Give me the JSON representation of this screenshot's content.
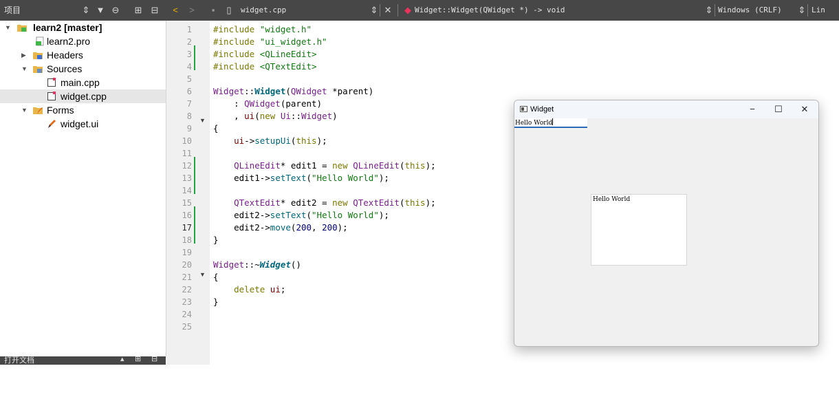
{
  "topbar": {
    "project_label": "项目",
    "file_name": "widget.cpp",
    "symbol": "Widget::Widget(QWidget *) -> void",
    "line_ending": "Windows (CRLF)",
    "line_label": "Lin"
  },
  "tree": {
    "project": "learn2 [master]",
    "pro_file": "learn2.pro",
    "headers": "Headers",
    "sources": "Sources",
    "main_cpp": "main.cpp",
    "widget_cpp": "widget.cpp",
    "forms": "Forms",
    "widget_ui": "widget.ui"
  },
  "open_docs_label": "打开文档",
  "line_numbers": [
    "1",
    "2",
    "3",
    "4",
    "5",
    "6",
    "7",
    "8",
    "9",
    "10",
    "11",
    "12",
    "13",
    "14",
    "15",
    "16",
    "17",
    "18",
    "19",
    "20",
    "21",
    "22",
    "23",
    "24",
    "25"
  ],
  "code": {
    "l1_kw": "#include",
    "l1_str": "\"widget.h\"",
    "l2_kw": "#include",
    "l2_str": "\"ui_widget.h\"",
    "l3_kw": "#include",
    "l3_str": "<QLineEdit>",
    "l4_kw": "#include",
    "l4_str": "<QTextEdit>",
    "l6_cls": "Widget",
    "l6_sep": "::",
    "l6_fn": "Widget",
    "l6_open": "(",
    "l6_type": "QWidget",
    "l6_rest": " *parent)",
    "l7_pre": "    : ",
    "l7_type": "QWidget",
    "l7_rest": "(parent)",
    "l8_pre": "    , ",
    "l8_mem": "ui",
    "l8_o": "(",
    "l8_kw": "new",
    "l8_sp": " ",
    "l8_ns": "Ui",
    "l8_sep": "::",
    "l8_cls": "Widget",
    "l8_c": ")",
    "l9": "{",
    "l10_pre": "    ",
    "l10_mem": "ui",
    "l10_arr": "->",
    "l10_fn": "setupUi",
    "l10_o": "(",
    "l10_kw": "this",
    "l10_c": ");",
    "l12_pre": "    ",
    "l12_type": "QLineEdit",
    "l12_mid": "* edit1 = ",
    "l12_kw": "new",
    "l12_sp": " ",
    "l12_type2": "QLineEdit",
    "l12_o": "(",
    "l12_kw2": "this",
    "l12_c": ");",
    "l13_pre": "    edit1->",
    "l13_fn": "setText",
    "l13_o": "(",
    "l13_str": "\"Hello World\"",
    "l13_c": ");",
    "l15_pre": "    ",
    "l15_type": "QTextEdit",
    "l15_mid": "* edit2 = ",
    "l15_kw": "new",
    "l15_sp": " ",
    "l15_type2": "QTextEdit",
    "l15_o": "(",
    "l15_kw2": "this",
    "l15_c": ");",
    "l16_pre": "    edit2->",
    "l16_fn": "setText",
    "l16_o": "(",
    "l16_str": "\"Hello World\"",
    "l16_c": ");",
    "l17_pre": "    edit2->",
    "l17_fn": "move",
    "l17_o": "(",
    "l17_n1": "200",
    "l17_comma": ", ",
    "l17_n2": "200",
    "l17_c": ");",
    "l18": "}",
    "l20_cls": "Widget",
    "l20_sep": "::~",
    "l20_fn": "Widget",
    "l20_c": "()",
    "l21": "{",
    "l22_pre": "    ",
    "l22_kw": "delete",
    "l22_sp": " ",
    "l22_mem": "ui",
    "l22_c": ";",
    "l23": "}"
  },
  "app_window": {
    "title": "Widget",
    "minimize": "−",
    "maximize": "☐",
    "close": "✕",
    "line_edit_text": "Hello World",
    "text_edit_text": "Hello World"
  }
}
